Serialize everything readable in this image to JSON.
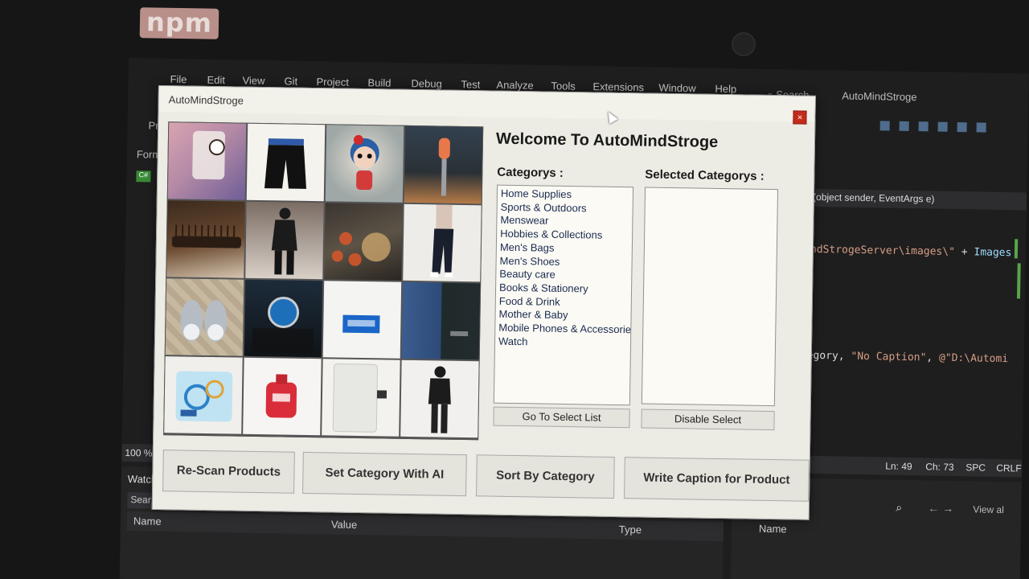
{
  "npm_sticker": "npm",
  "vs": {
    "menu": [
      "File",
      "Edit",
      "View",
      "Git",
      "Project",
      "Build",
      "Debug",
      "Test",
      "Analyze",
      "Tools",
      "Extensions",
      "Window",
      "Help"
    ],
    "search": "Search",
    "title": "AutoMindStroge",
    "left_tab": "Form",
    "left_ps": "Pr",
    "code_header": "(object sender, EventArgs e)",
    "code_line1_str": "ndStrogeServer\\images\\\"",
    "code_line1_plain": " + ",
    "code_line1_ident": "Images",
    "code_line2_plain": "egory, ",
    "code_line2_str1": "\"No Caption\"",
    "code_line2_plain2": ", ",
    "code_line2_str2": "@\"D:\\Automi",
    "status": {
      "zoom": "100 %",
      "line": "Ln: 49",
      "col": "Ch: 73",
      "mode": "SPC",
      "eol": "CRLF"
    },
    "watch_title": "Watch",
    "watch_search": "Sear",
    "watch_columns": [
      "Name",
      "Value",
      "Type"
    ],
    "right_name_column": "Name",
    "view_all": "View al"
  },
  "dialog": {
    "title": "AutoMindStroge",
    "close_label": "×",
    "welcome": "Welcome To AutoMindStroge",
    "categories_label": "Categorys :",
    "selected_label": "Selected Categorys :",
    "categories": [
      "Home Supplies",
      "Sports & Outdoors",
      "Menswear",
      "Hobbies & Collections",
      "Men's Bags",
      "Men's Shoes",
      "Beauty care",
      "Books & Stationery",
      "Food & Drink",
      "Mother & Baby",
      "Mobile Phones & Accessories",
      "Watch"
    ],
    "buttons": {
      "go_to_select": "Go To Select List",
      "disable_select": "Disable Select",
      "rescan": "Re-Scan Products",
      "set_category_ai": "Set Category With AI",
      "sort_by_category": "Sort By Category",
      "write_caption": "Write Caption for Product"
    },
    "thumbnails": [
      "watch-on-pink",
      "black-shorts",
      "toy-doll",
      "bollard-street",
      "hair-comb",
      "man-in-suit",
      "tea-set",
      "man-in-jeans",
      "baby-shoes",
      "wrist-watch",
      "blue-label-card",
      "jeans-and-bag",
      "toy-track-set",
      "detergent-bottle",
      "water-dispenser",
      "man-standing"
    ]
  }
}
